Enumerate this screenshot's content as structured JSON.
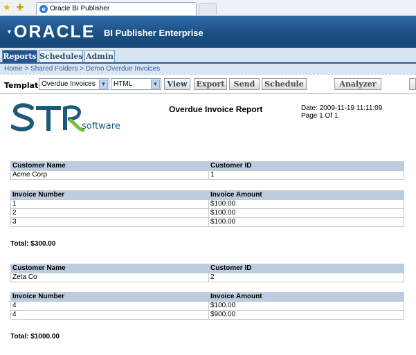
{
  "browser": {
    "tab_title": "Oracle BI Publisher"
  },
  "header": {
    "logo_text": "ORACLE",
    "product": "BI Publisher Enterprise"
  },
  "app_tabs": [
    {
      "label": "Reports",
      "active": true
    },
    {
      "label": "Schedules",
      "active": false
    },
    {
      "label": "Admin",
      "active": false
    }
  ],
  "breadcrumb": "Home > Shared Folders > Demo Overdue Invoices",
  "toolbar": {
    "template_label": "Template",
    "template_value": "Overdue Invoices",
    "format_value": "HTML",
    "view": "View",
    "export": "Export",
    "send": "Send",
    "schedule": "Schedule",
    "analyzer": "Analyzer"
  },
  "report": {
    "logo_brand": "STR",
    "logo_sub": "software",
    "title": "Overdue Invoice Report",
    "date": "Date: 2009-11-19 11:11:09",
    "page": "Page 1 Of 1",
    "customer_headers": [
      "Customer Name",
      "Customer ID"
    ],
    "invoice_headers": [
      "Invoice Number",
      "Invoice Amount"
    ],
    "customers": [
      {
        "name": "Acme Corp",
        "id": "1",
        "invoices": [
          {
            "number": "1",
            "amount": "$100.00"
          },
          {
            "number": "2",
            "amount": "$100.00"
          },
          {
            "number": "3",
            "amount": "$100.00"
          }
        ],
        "total": "Total: $300.00"
      },
      {
        "name": "Zeta Co",
        "id": "2",
        "invoices": [
          {
            "number": "4",
            "amount": "$100.00"
          },
          {
            "number": "4",
            "amount": "$900.00"
          }
        ],
        "total": "Total: $1000.00"
      }
    ]
  },
  "colors": {
    "header_blue": "#1b4f84",
    "table_header": "#bccde1",
    "logo_teal": "#1c5a7a"
  }
}
